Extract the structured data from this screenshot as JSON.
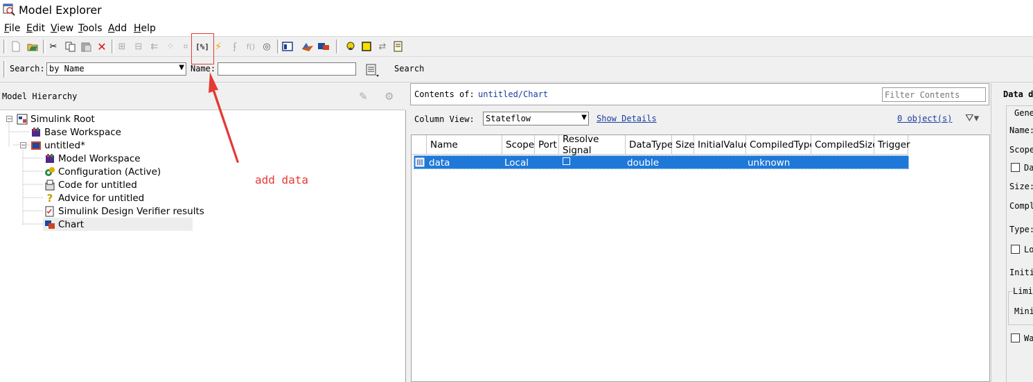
{
  "window": {
    "title": "Model Explorer"
  },
  "menu": [
    {
      "key": "F",
      "rest": "ile"
    },
    {
      "key": "E",
      "rest": "dit"
    },
    {
      "key": "V",
      "rest": "iew"
    },
    {
      "key": "T",
      "rest": "ools"
    },
    {
      "key": "A",
      "rest": "dd"
    },
    {
      "key": "H",
      "rest": "elp"
    }
  ],
  "search": {
    "label": "Search:",
    "by_value": "by Name",
    "name_label": "Name:",
    "name_value": "",
    "search_button": "Search"
  },
  "hierarchy": {
    "title": "Model Hierarchy",
    "items": [
      {
        "label": "Simulink Root"
      },
      {
        "label": "Base Workspace"
      },
      {
        "label": "untitled*"
      },
      {
        "label": "Model Workspace"
      },
      {
        "label": "Configuration (Active)"
      },
      {
        "label": "Code for untitled"
      },
      {
        "label": "Advice for untitled"
      },
      {
        "label": "Simulink Design Verifier results"
      },
      {
        "label": "Chart"
      }
    ]
  },
  "contents": {
    "label": "Contents of:",
    "path": "untitled/Chart",
    "filter_placeholder": "Filter Contents",
    "column_view_label": "Column View:",
    "column_view_value": "Stateflow",
    "show_details": "Show Details",
    "object_count": "0 object(s)",
    "columns": [
      "Name",
      "Scope",
      "Port",
      "Resolve Signal",
      "DataType",
      "Size",
      "InitialValue",
      "CompiledType",
      "CompiledSize",
      "Trigger"
    ],
    "rows": [
      {
        "name": "data",
        "scope": "Local",
        "port": "",
        "datatype": "double",
        "size": "",
        "initial": "",
        "compiled_type": "unknown",
        "compiled_size": "",
        "trigger": ""
      }
    ]
  },
  "dialog": {
    "title": "Data d",
    "general_tab": "Gene",
    "name_label": "Name:",
    "scope_label": "Scope",
    "data_check": "Da",
    "size_label": "Size:",
    "complexity_label": "Compl",
    "type_label": "Type:",
    "lock_check": "Lo",
    "initial_label": "Initi",
    "limit_label": "Limi",
    "min_label": "Mini",
    "watch_check": "Wa"
  },
  "annotation": {
    "text": "add data",
    "color": "#e53935"
  }
}
